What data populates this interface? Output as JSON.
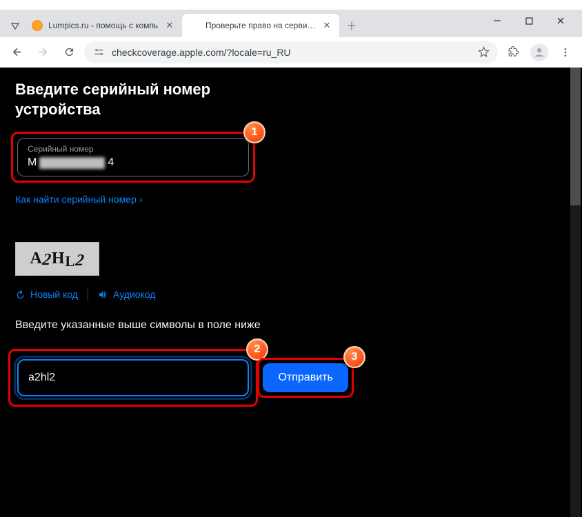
{
  "window": {
    "tabs": [
      {
        "title": "Lumpics.ru - помощь с компь",
        "favicon": "orange"
      },
      {
        "title": "Проверьте право на сервисно",
        "favicon": "apple"
      }
    ]
  },
  "toolbar": {
    "url": "checkcoverage.apple.com/?locale=ru_RU"
  },
  "page": {
    "heading": "Введите серийный номер устройства",
    "serial_field": {
      "label": "Серийный номер",
      "value_prefix": "M",
      "value_suffix": "4"
    },
    "help_link": "Как найти серийный номер",
    "captcha_text": "A2HL2",
    "captcha_actions": {
      "new_code": "Новый код",
      "audio_code": "Аудиокод"
    },
    "captcha_instruction": "Введите указанные выше символы в поле ниже",
    "captcha_input_value": "a2hl2",
    "submit_label": "Отправить"
  },
  "annotations": {
    "badge1": "1",
    "badge2": "2",
    "badge3": "3"
  }
}
